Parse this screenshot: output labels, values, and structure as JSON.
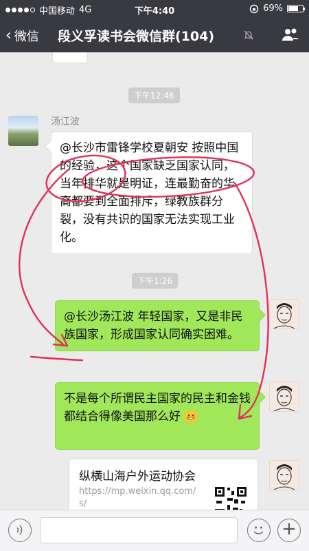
{
  "status_bar": {
    "carrier": "中国移动",
    "network": "4G",
    "time": "下午4:40",
    "battery": "69%",
    "battery_level": 0.69
  },
  "nav": {
    "back_label": "微信",
    "title": "段义孚读书会微信群(104)"
  },
  "messages": {
    "time1": "下午12:46",
    "sender1": "汤江波",
    "bubble1": "@长沙市雷锋学校夏朝安 按照中国的经验，这个国家缺乏国家认同，当年排华就是明证，连最勤奋的华裔都要到全面排斥，绿教族群分裂，没有共识的国家无法实现工业化。",
    "time2": "下午1:26",
    "bubble2": "@长沙汤江波 年轻国家，又是非民族国家，形成国家认同确实困难。",
    "bubble3": "不是每个所谓民主国家的民主和金钱都结合得像美国那么好",
    "link_card": {
      "title": "纵横山海户外运动协会",
      "url": "https://mp.weixin.qq.com/s/"
    }
  },
  "input": {
    "placeholder": ""
  },
  "colors": {
    "nav_bg": "#393a3f",
    "chat_bg": "#ebebeb",
    "green_bubble": "#a0e75a",
    "annotation": "#e0305a"
  }
}
